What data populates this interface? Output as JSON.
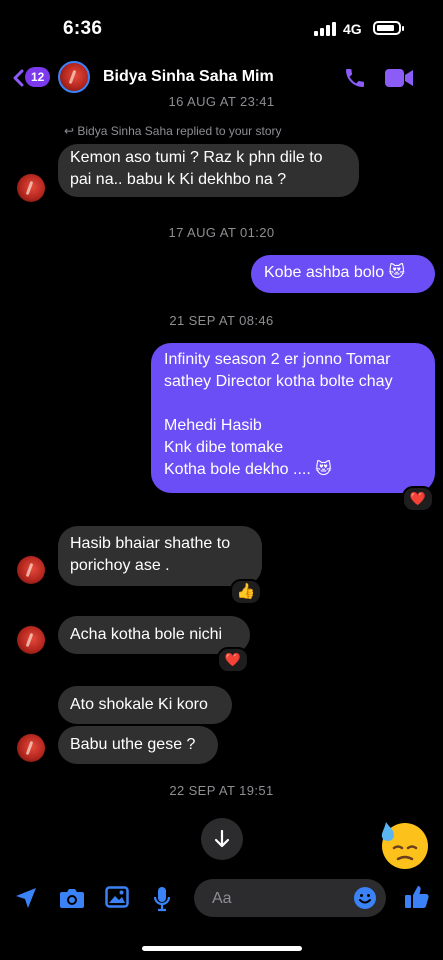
{
  "status_bar": {
    "time": "6:36",
    "network": "4G"
  },
  "header": {
    "unread_count": "12",
    "contact_name": "Bidya Sinha Saha Mim",
    "accent_color": "#8b5cf6"
  },
  "chat": {
    "date_partial": "16 AUG AT 23:41",
    "reply_note": "Bidya Sinha Saha replied to your story",
    "msg1_line1": "Kemon aso tumi ? Raz k phn dile to",
    "msg1_line2": "pai na.. babu k Ki dekhbo na ?",
    "date2": "17 AUG AT 01:20",
    "msg2": "Kobe ashba bolo 😻",
    "date3": "21 SEP AT 08:46",
    "msg3_line1": "Infinity season 2 er jonno Tomar",
    "msg3_line2": "sathey Director kotha bolte chay",
    "msg3_line3": "Mehedi Hasib",
    "msg3_line4": "Knk dibe tomake",
    "msg3_line5": "Kotha bole dekho .... 😻",
    "msg3_reaction": "❤️",
    "msg4_line1": "Hasib bhaiar shathe to",
    "msg4_line2": "porichoy ase .",
    "msg4_reaction": "👍",
    "msg5": "Acha kotha bole nichi",
    "msg5_reaction": "❤️",
    "msg6": "Ato shokale Ki koro",
    "msg7": "Babu uthe gese ?",
    "date4": "22 SEP AT 19:51",
    "big_emoji": "😓"
  },
  "composer": {
    "placeholder": "Aa"
  },
  "icons": {
    "back": "chevron-left-icon",
    "call": "phone-icon",
    "video": "video-camera-icon",
    "location": "send-location-icon",
    "camera": "camera-icon",
    "gallery": "image-icon",
    "mic": "microphone-icon",
    "emoji": "smiley-icon",
    "like": "thumbs-up-icon"
  }
}
